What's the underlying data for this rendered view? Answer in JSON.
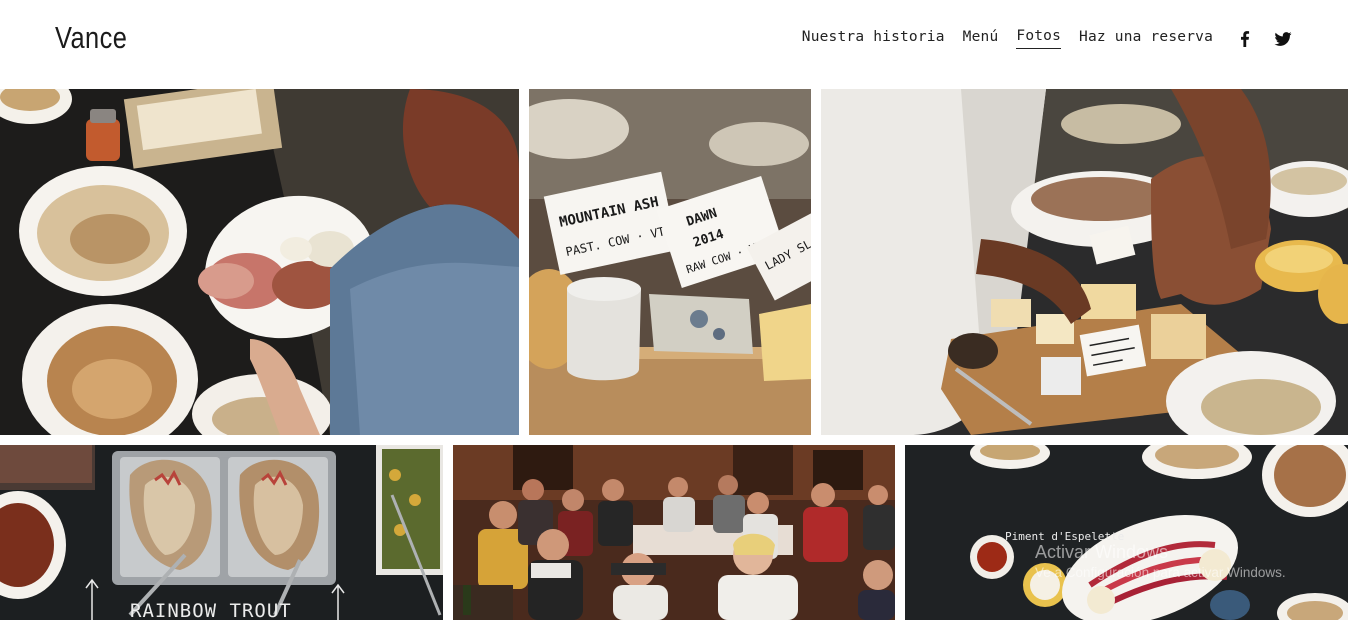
{
  "site": {
    "logo": "Vance"
  },
  "nav": {
    "items": [
      {
        "label": "Nuestra historia",
        "active": false
      },
      {
        "label": "Menú",
        "active": false
      },
      {
        "label": "Fotos",
        "active": true
      },
      {
        "label": "Haz una reserva",
        "active": false
      }
    ],
    "social": [
      "facebook-icon",
      "twitter-icon"
    ]
  },
  "gallery": {
    "photos": [
      {
        "name": "photo-cheese-plate-hand",
        "subject": "Hand holding plate of cheese and charcuterie over buffet"
      },
      {
        "name": "photo-cheese-labels",
        "subject": "Cheeses with handwritten labels",
        "labels": [
          "MOUNTAIN ASH",
          "PAST. COW · VT",
          "DAWN",
          "2014",
          "RAW COW · VT",
          "LADY SL"
        ]
      },
      {
        "name": "photo-cutting-cheese",
        "subject": "Person slicing cheese on wooden board"
      },
      {
        "name": "photo-rainbow-trout",
        "subject": "Trays of roasted trout on chalkboard table",
        "chalk": "RAINBOW TROUT"
      },
      {
        "name": "photo-dining-room",
        "subject": "Guests dining at long tables in wood-paneled room"
      },
      {
        "name": "photo-platters",
        "subject": "Platters of radishes and dips on chalkboard",
        "chalk": "Piment d'Espelette"
      }
    ]
  },
  "os_watermark": {
    "line1": "Activar Windows",
    "line2": "Ve a Configuración para activar Windows."
  },
  "colors": {
    "text": "#222222",
    "background": "#ffffff",
    "chalkboard": "#1f2224"
  }
}
